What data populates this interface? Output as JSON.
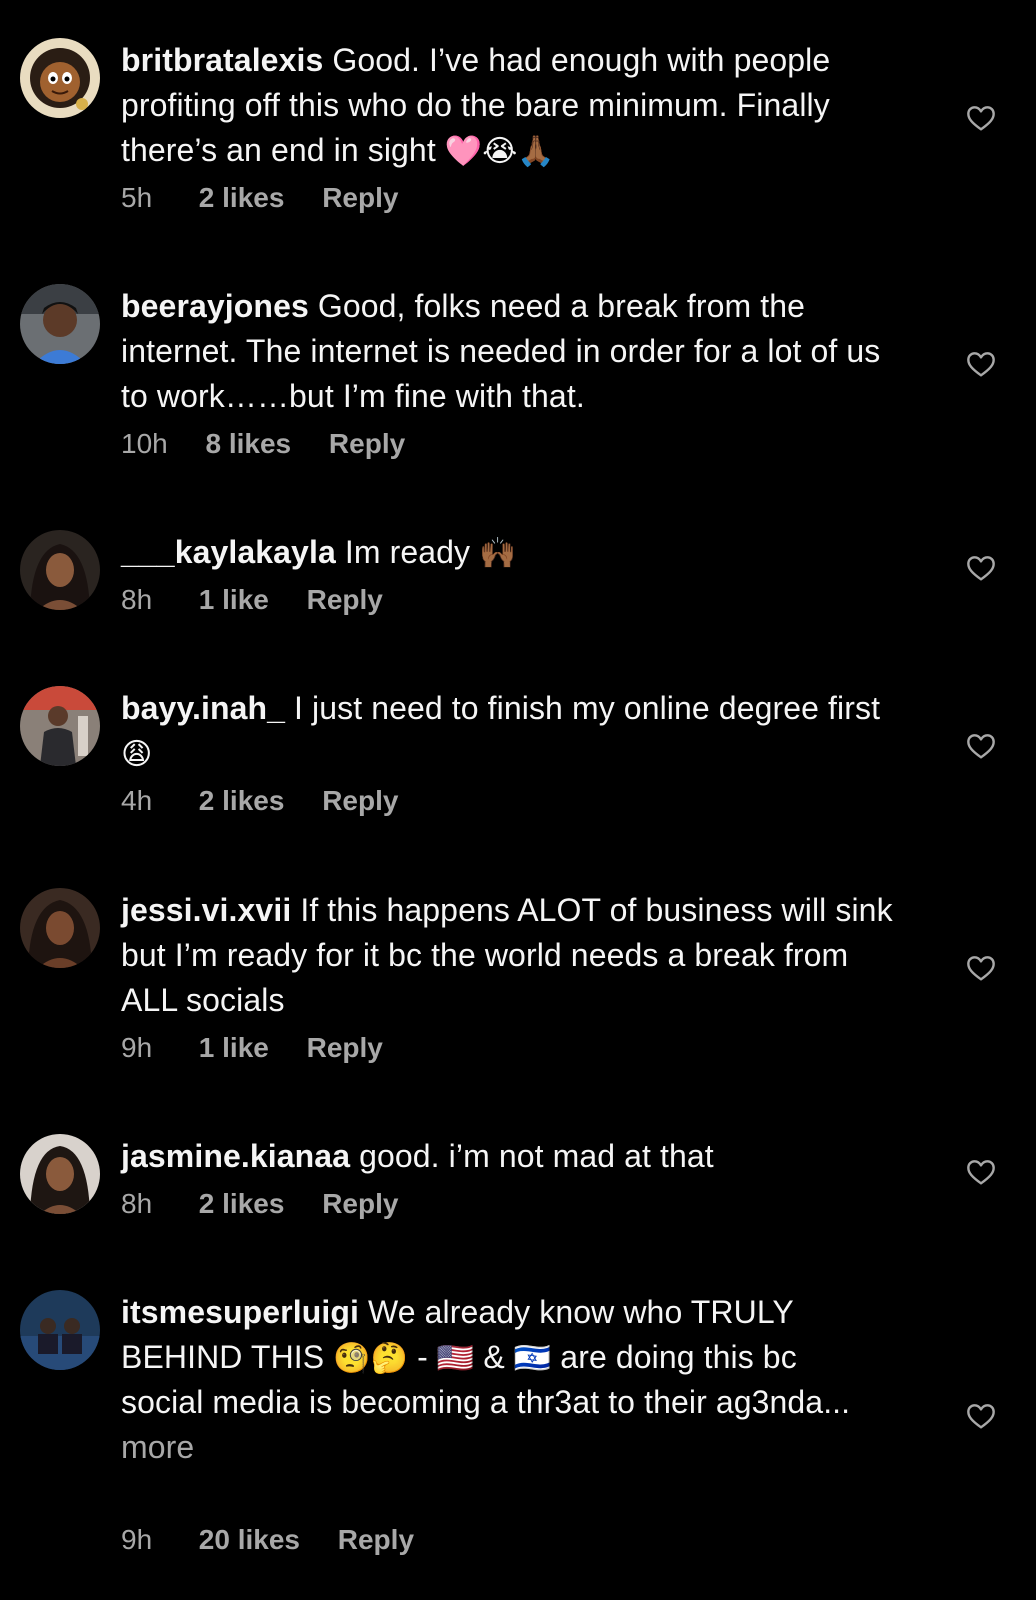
{
  "comments": [
    {
      "username": "britbratalexis",
      "text": "Good. I’ve had enough with people profiting off this who do the bare minimum. Finally there’s an end in sight",
      "emoji": "🩷😭🙏🏾",
      "time": "5h",
      "likes": "2 likes",
      "reply": "Reply"
    },
    {
      "username": "beerayjones",
      "text": "Good, folks need a break from the internet. The internet is needed in order for a lot of us to work……but I’m fine with that.",
      "emoji": "",
      "time": "10h",
      "likes": "8 likes",
      "reply": "Reply"
    },
    {
      "username": "___kaylakayla",
      "text": "Im ready",
      "emoji": "🙌🏾",
      "time": "8h",
      "likes": "1 like",
      "reply": "Reply"
    },
    {
      "username": "bayy.inah_",
      "text": "I just need to finish my online degree first",
      "emoji": "😩",
      "time": "4h",
      "likes": "2 likes",
      "reply": "Reply"
    },
    {
      "username": "jessi.vi.xvii",
      "text": "If this happens ALOT of business will sink but I’m ready for it bc the world needs a break from ALL socials",
      "emoji": "",
      "time": "9h",
      "likes": "1 like",
      "reply": "Reply"
    },
    {
      "username": "jasmine.kianaa",
      "text": "good. i’m not mad at that",
      "emoji": "",
      "time": "8h",
      "likes": "2 likes",
      "reply": "Reply"
    },
    {
      "username": "itsmesuperluigi",
      "text_part1": "We already know who TRULY BEHIND THIS",
      "emoji1": "🧐🤔",
      "text_part2": "-",
      "emoji_flag1": "🇺🇸",
      "text_part3": "&",
      "emoji_flag2": "🇮🇱",
      "text_part4": "are doing this bc social media is becoming a thr3at to their ag3nda...",
      "more": "more",
      "time": "9h",
      "likes": "20 likes",
      "reply": "Reply"
    }
  ],
  "icons": {
    "like": "heart-outline-icon",
    "avatar": "user-avatar"
  },
  "colors": {
    "background": "#000000",
    "text": "#f5f5f5",
    "secondary": "#a8a8a8"
  }
}
